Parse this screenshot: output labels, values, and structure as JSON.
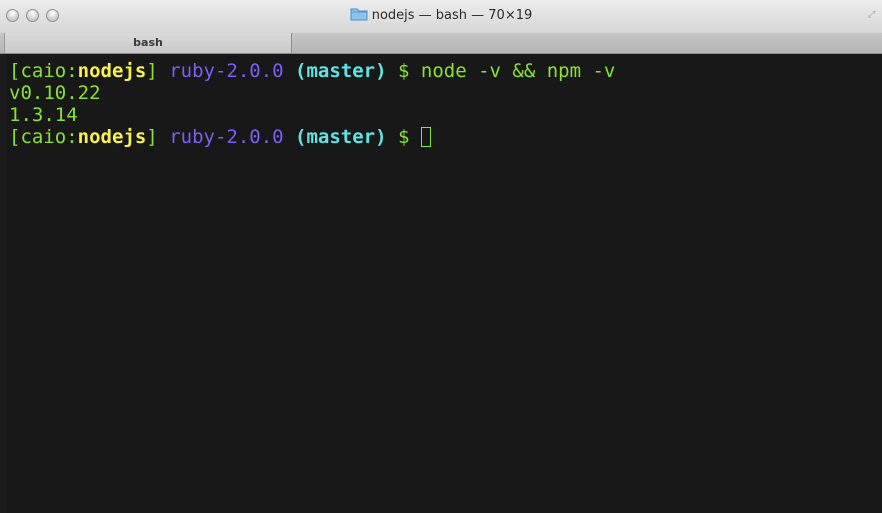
{
  "window": {
    "title": "nodejs — bash — 70×19",
    "title_icon": "folder-icon",
    "tab_label": "bash"
  },
  "colors": {
    "background": "#181818",
    "prompt_bracket": "#8ae233",
    "prompt_dir": "#f7f24e",
    "ruby": "#7b5ef2",
    "branch": "#62e3e3",
    "output": "#8ae233"
  },
  "terminal": {
    "lines": [
      {
        "user": "[caio:",
        "dir": "nodejs",
        "close": "]",
        "ruby": "ruby-2.0.0",
        "branch": "(master)",
        "prompt": "$",
        "command": "node -v && npm -v"
      },
      {
        "output": "v0.10.22"
      },
      {
        "output": "1.3.14"
      },
      {
        "user": "[caio:",
        "dir": "nodejs",
        "close": "]",
        "ruby": "ruby-2.0.0",
        "branch": "(master)",
        "prompt": "$",
        "command": ""
      }
    ]
  }
}
